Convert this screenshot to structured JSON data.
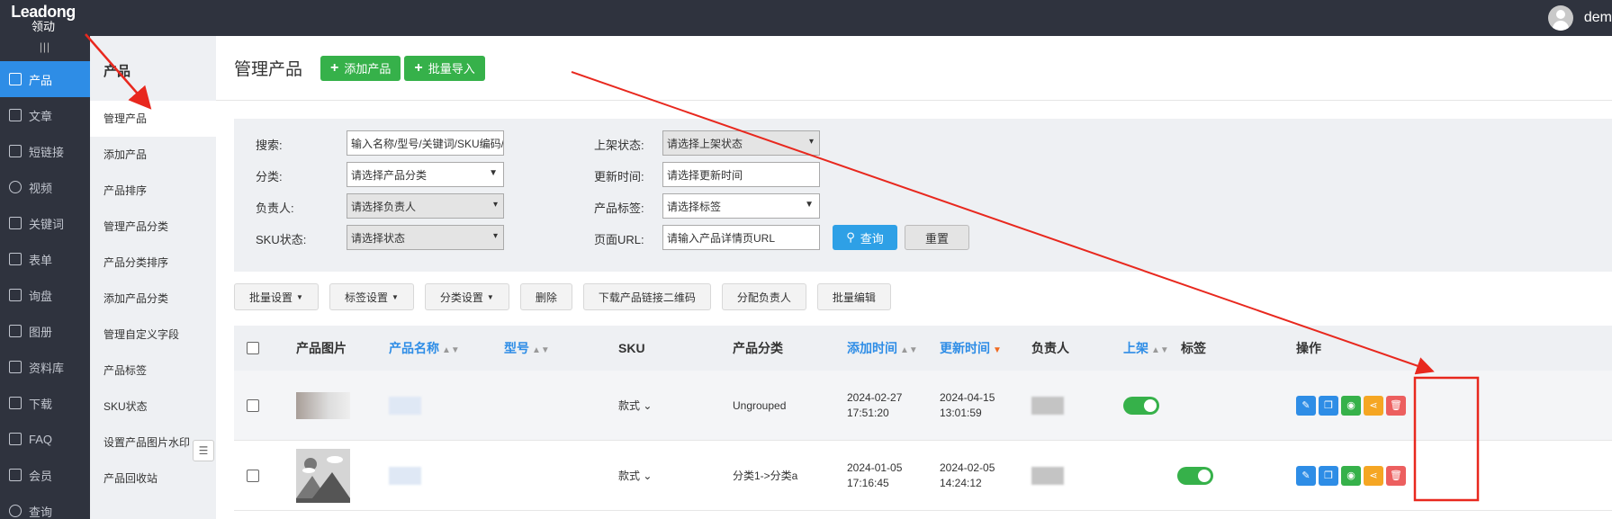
{
  "topbar": {
    "logo_en": "Leadong",
    "logo_cn": "领动",
    "username": "dem"
  },
  "sidebar": {
    "collapse_label": "|||",
    "items": [
      {
        "label": "产品",
        "icon": "grid-icon",
        "active": true
      },
      {
        "label": "文章",
        "icon": "article-icon"
      },
      {
        "label": "短链接",
        "icon": "link-icon"
      },
      {
        "label": "视频",
        "icon": "video-icon"
      },
      {
        "label": "关键词",
        "icon": "keyword-icon"
      },
      {
        "label": "表单",
        "icon": "form-icon"
      },
      {
        "label": "询盘",
        "icon": "inquiry-icon"
      },
      {
        "label": "图册",
        "icon": "album-icon"
      },
      {
        "label": "资料库",
        "icon": "library-icon"
      },
      {
        "label": "下载",
        "icon": "download-icon"
      },
      {
        "label": "FAQ",
        "icon": "faq-icon"
      },
      {
        "label": "会员",
        "icon": "member-icon"
      },
      {
        "label": "查询",
        "icon": "query-icon"
      }
    ]
  },
  "subnav": {
    "title": "产品",
    "items": [
      "管理产品",
      "添加产品",
      "产品排序",
      "管理产品分类",
      "产品分类排序",
      "添加产品分类",
      "管理自定义字段",
      "产品标签",
      "SKU状态",
      "设置产品图片水印",
      "产品回收站"
    ],
    "toggle_label": "☰"
  },
  "header": {
    "title": "管理产品",
    "add_label": "添加产品",
    "import_label": "批量导入"
  },
  "filters": {
    "search_label": "搜索:",
    "search_value": "输入名称/型号/关键词/SKU编码/条形",
    "status_label": "上架状态:",
    "status_value": "请选择上架状态",
    "category_label": "分类:",
    "category_value": "请选择产品分类",
    "update_label": "更新时间:",
    "update_value": "请选择更新时间",
    "owner_label": "负责人:",
    "owner_value": "请选择负责人",
    "tag_label": "产品标签:",
    "tag_value": "请选择标签",
    "sku_label": "SKU状态:",
    "sku_value": "请选择状态",
    "url_label": "页面URL:",
    "url_value": "请输入产品详情页URL",
    "search_btn": "查询",
    "reset_btn": "重置"
  },
  "toolbar": [
    "批量设置",
    "标签设置",
    "分类设置",
    "删除",
    "下载产品链接二维码",
    "分配负责人",
    "批量编辑"
  ],
  "table": {
    "headers": {
      "image": "产品图片",
      "name": "产品名称",
      "model": "型号",
      "sku": "SKU",
      "category": "产品分类",
      "added": "添加时间",
      "updated": "更新时间",
      "owner": "负责人",
      "listed": "上架",
      "tags": "标签",
      "actions": "操作"
    },
    "rows": [
      {
        "sku": "款式",
        "category": "Ungrouped",
        "added_date": "2024-02-27",
        "added_time": "17:51:20",
        "updated_date": "2024-04-15",
        "updated_time": "13:01:59",
        "listed": true
      },
      {
        "sku": "款式",
        "category": "分类1->分类a",
        "added_date": "2024-01-05",
        "added_time": "17:16:45",
        "updated_date": "2024-02-05",
        "updated_time": "14:24:12",
        "listed": true
      }
    ]
  },
  "colors": {
    "primary": "#2e8de6",
    "green": "#36b14a",
    "annotation": "#e8281e"
  }
}
